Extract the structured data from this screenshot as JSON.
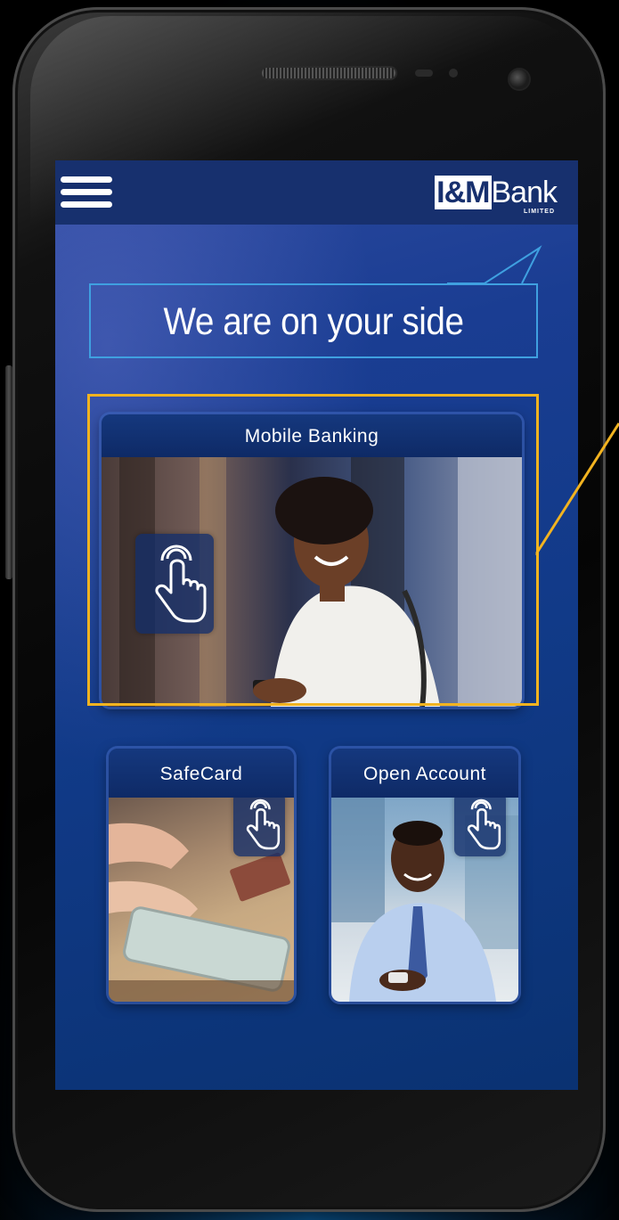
{
  "app": {
    "logo_text_bold": "I&M",
    "logo_text_light": "Bank",
    "logo_subtext": "LIMITED"
  },
  "tagline": "We are on your side",
  "cards": {
    "mobile_banking": {
      "label": "Mobile Banking"
    },
    "safecard": {
      "label": "SafeCard"
    },
    "open_account": {
      "label": "Open Account"
    }
  },
  "icons": {
    "menu": "hamburger-menu-icon",
    "tap": "hand-tap-icon"
  },
  "colors": {
    "brand_blue": "#17306e",
    "highlight": "#f2b320",
    "tagline_border": "#3fa0e0"
  }
}
